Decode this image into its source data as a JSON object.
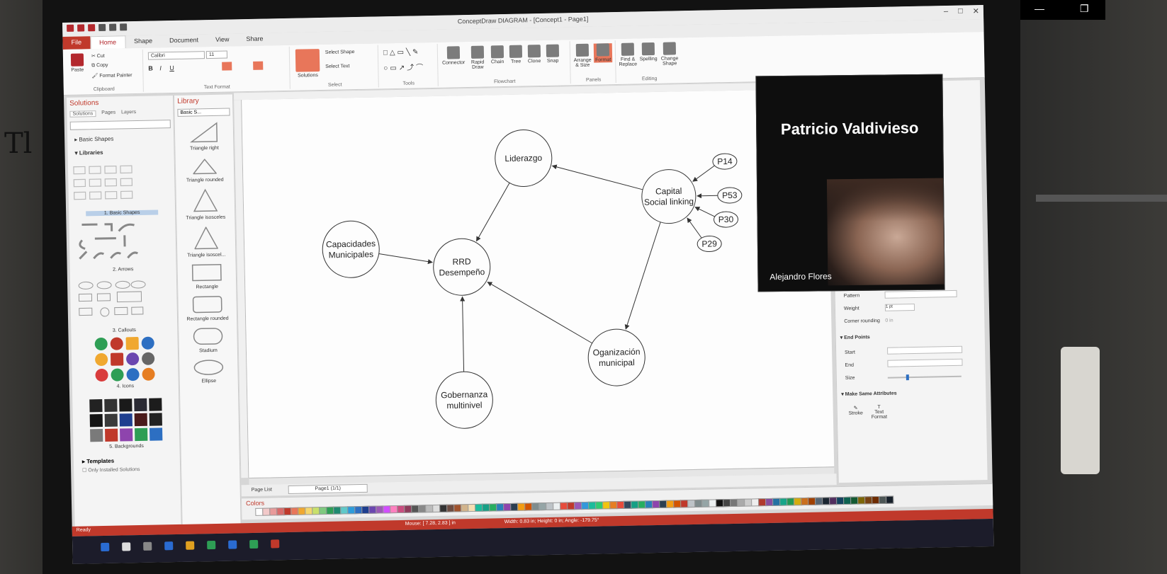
{
  "app": {
    "window_title": "ConceptDraw DIAGRAM - [Concept1 - Page1]",
    "tabs": [
      "File",
      "Home",
      "Shape",
      "Document",
      "View",
      "Share"
    ],
    "active_tab": "Home"
  },
  "ribbon": {
    "clipboard": {
      "paste": "Paste",
      "cut": "Cut",
      "copy": "Copy",
      "format_painter": "Format Painter",
      "group": "Clipboard"
    },
    "text_format": {
      "font": "Calibri",
      "size": "11",
      "group": "Text Format"
    },
    "select": {
      "solutions": "Solutions",
      "select_shape": "Select Shape",
      "select_text": "Select Text",
      "group": "Select"
    },
    "tools": {
      "group": "Tools"
    },
    "flowchart": {
      "connector": "Connector",
      "rapid_draw": "Rapid Draw",
      "chain": "Chain",
      "tree": "Tree",
      "clone": "Clone",
      "snap": "Snap",
      "group": "Flowchart"
    },
    "panels": {
      "arrange": "Arrange & Size",
      "format": "Format",
      "group": "Panels"
    },
    "editing": {
      "find": "Find & Replace",
      "spelling": "Spelling",
      "change_shape": "Change Shape",
      "group": "Editing"
    }
  },
  "solutions_panel": {
    "title": "Solutions",
    "subtabs": [
      "Solutions",
      "Pages",
      "Layers"
    ],
    "tree": [
      "Basic Shapes",
      "Libraries"
    ],
    "libraries": [
      "1. Basic Shapes",
      "2. Arrows",
      "3. Callouts",
      "4. Icons",
      "5. Backgrounds"
    ],
    "templates": "Templates",
    "only_installed": "Only Installed Solutions"
  },
  "library_panel": {
    "title": "Library",
    "dropdown": "Basic S...",
    "shapes": [
      "Triangle right",
      "Triangle rounded",
      "Triangle isosceles",
      "Triangle isoscel...",
      "Rectangle",
      "Rectangle rounded",
      "Stadium",
      "Ellipse"
    ]
  },
  "diagram": {
    "nodes": [
      {
        "id": "liderazgo",
        "label": [
          "Liderazgo"
        ]
      },
      {
        "id": "capital",
        "label": [
          "Capital",
          "Social linking"
        ]
      },
      {
        "id": "capacidades",
        "label": [
          "Capacidades",
          "Municipales"
        ]
      },
      {
        "id": "rrd",
        "label": [
          "RRD",
          "Desempeño"
        ]
      },
      {
        "id": "organizacion",
        "label": [
          "Oganización",
          "municipal"
        ]
      },
      {
        "id": "gobernanza",
        "label": [
          "Gobernanza",
          "multinivel"
        ]
      },
      {
        "id": "p14",
        "label": [
          "P14"
        ]
      },
      {
        "id": "p53",
        "label": [
          "P53"
        ]
      },
      {
        "id": "p30",
        "label": [
          "P30"
        ]
      },
      {
        "id": "p29",
        "label": [
          "P29"
        ]
      }
    ],
    "edges": [
      [
        "capital",
        "liderazgo"
      ],
      [
        "liderazgo",
        "rrd"
      ],
      [
        "capacidades",
        "rrd"
      ],
      [
        "capital",
        "organizacion"
      ],
      [
        "organizacion",
        "rrd"
      ],
      [
        "gobernanza",
        "rrd"
      ],
      [
        "p14",
        "capital"
      ],
      [
        "p53",
        "capital"
      ],
      [
        "p30",
        "capital"
      ],
      [
        "p29",
        "capital"
      ]
    ]
  },
  "page_bar": {
    "page_list": "Page List",
    "page": "Page1 (1/1)"
  },
  "colors_bar": {
    "label": "Colors"
  },
  "status_bar": {
    "ready": "Ready",
    "mouse": "Mouse: [ 7.28, 2.83 ] in",
    "dims": "Width: 0.83 in; Height: 0 in; Angle: -179.75°"
  },
  "format_panel": {
    "pattern": "Pattern",
    "weight": "Weight",
    "weight_value": "1 pt",
    "corner_rounding": "Corner rounding",
    "corner_value": "0 in",
    "end_points": "End Points",
    "start": "Start",
    "end": "End",
    "size": "Size",
    "make_same": "Make Same Attributes",
    "stroke": "Stroke",
    "text_format": "Text Format"
  },
  "video_call": {
    "name": "Patricio Valdivieso",
    "caption": "Alejandro Flores"
  }
}
